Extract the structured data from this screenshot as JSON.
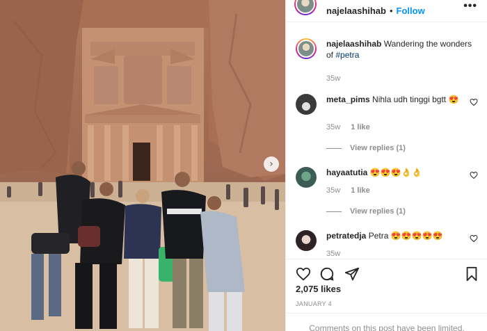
{
  "post": {
    "photo_alt": "Group of five people in front of the Treasury at Petra",
    "next_icon": "chevron-right-icon"
  },
  "header": {
    "username": "najelaashihab",
    "separator": "•",
    "follow_label": "Follow",
    "more_label": "•••"
  },
  "caption": {
    "username": "najelaashihab",
    "text": "Wandering the wonders of",
    "hashtag": "#petra",
    "time": "35w"
  },
  "comments": [
    {
      "username": "meta_pims",
      "text": "Nihla udh tinggi bgtt 😍",
      "time": "35w",
      "likes": "1 like",
      "replies": "View replies (1)"
    },
    {
      "username": "hayaatutia",
      "text": "😍😍😍👌👌",
      "time": "35w",
      "likes": "1 like",
      "replies": "View replies (1)"
    },
    {
      "username": "petratedja",
      "text": "Petra 😍😍😍😍😍",
      "time": "35w"
    }
  ],
  "footer": {
    "likes": "2,075 likes",
    "date": "JANUARY 4",
    "comments_disabled": "Comments on this post have been limited."
  },
  "colors": {
    "link_blue": "#0095f6",
    "hashtag": "#00376b",
    "muted": "#8e8e8e"
  }
}
